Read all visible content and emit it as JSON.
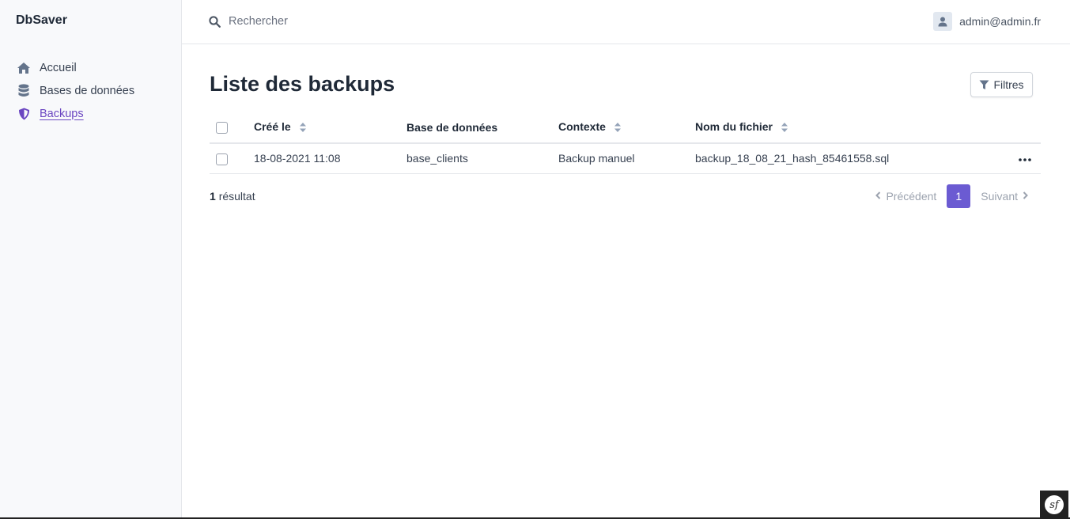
{
  "app": {
    "brand": "DbSaver"
  },
  "sidebar": {
    "items": [
      {
        "label": "Accueil",
        "icon": "home-icon",
        "active": false
      },
      {
        "label": "Bases de données",
        "icon": "database-icon",
        "active": false
      },
      {
        "label": "Backups",
        "icon": "shield-icon",
        "active": true
      }
    ]
  },
  "topbar": {
    "search_placeholder": "Rechercher",
    "user_email": "admin@admin.fr"
  },
  "main": {
    "title": "Liste des backups",
    "filter_label": "Filtres",
    "table": {
      "columns": [
        "Créé le",
        "Base de données",
        "Contexte",
        "Nom du fichier"
      ],
      "rows": [
        {
          "created": "18-08-2021 11:08",
          "database": "base_clients",
          "context": "Backup manuel",
          "filename": "backup_18_08_21_hash_85461558.sql"
        }
      ]
    },
    "result_count": "1",
    "result_label": "résultat",
    "pagination": {
      "prev": "Précédent",
      "current": "1",
      "next": "Suivant"
    }
  },
  "colors": {
    "accent": "#6b46c1",
    "page_active": "#6b5bd2",
    "sidebar_bg": "#f8f9fb"
  }
}
